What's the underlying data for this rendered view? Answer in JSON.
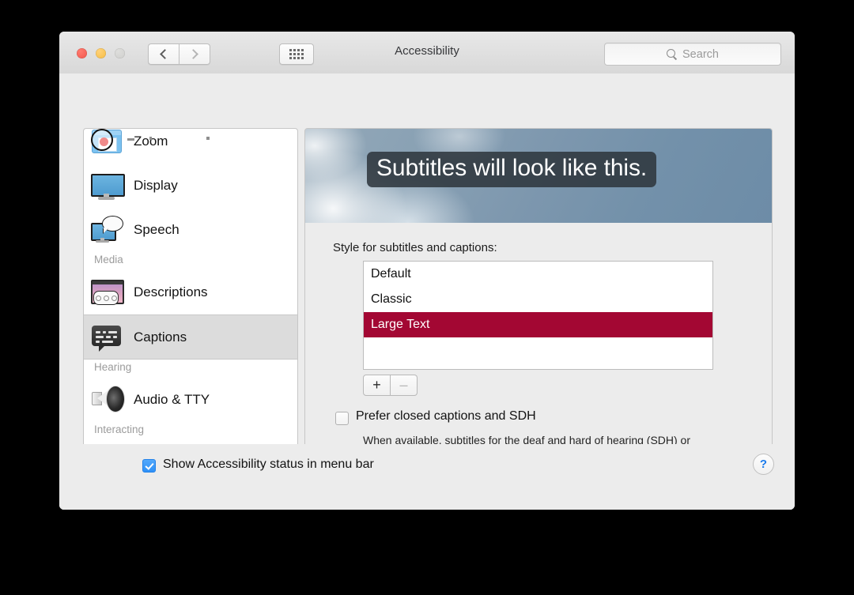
{
  "window": {
    "title": "Accessibility",
    "traffic_lights": [
      "close-button",
      "minimize-button",
      "zoom-button"
    ],
    "nav_back": "‹",
    "nav_forward": "›",
    "grid_button": "show-all-button",
    "search": {
      "placeholder": "Search",
      "value": "",
      "icon": "search-icon"
    }
  },
  "sidebar": {
    "items": [
      {
        "type": "item",
        "label": "Zoom",
        "icon": "zoom-icon",
        "selected": false
      },
      {
        "type": "item",
        "label": "Display",
        "icon": "display-icon",
        "selected": false
      },
      {
        "type": "item",
        "label": "Speech",
        "icon": "speech-icon",
        "selected": false
      },
      {
        "type": "group",
        "label": "Media"
      },
      {
        "type": "item",
        "label": "Descriptions",
        "icon": "descriptions-icon",
        "selected": false
      },
      {
        "type": "item",
        "label": "Captions",
        "icon": "captions-icon",
        "selected": true
      },
      {
        "type": "group",
        "label": "Hearing"
      },
      {
        "type": "item",
        "label": "Audio & TTY",
        "icon": "audio-tty-icon",
        "selected": false
      },
      {
        "type": "group",
        "label": "Interacting"
      },
      {
        "type": "item",
        "label": "",
        "icon": "keyboard-icon",
        "selected": false
      }
    ]
  },
  "panel": {
    "preview": {
      "caption_text": "Subtitles will look like this.",
      "caption_bg": "#2e363d",
      "caption_color": "#ffffff"
    },
    "style_label": "Style for subtitles and captions:",
    "styles": [
      {
        "label": "Default",
        "selected": false
      },
      {
        "label": "Classic",
        "selected": false
      },
      {
        "label": "Large Text",
        "selected": true
      }
    ],
    "selection_color": "#a30733",
    "add_button": "+",
    "remove_button": "–",
    "sdh": {
      "checked": false,
      "label": "Prefer closed captions and SDH",
      "description": "When available, subtitles for the deaf and hard of hearing (SDH) or closed captions will be used instead of standard subtitles."
    }
  },
  "bottom": {
    "menubar_checkbox_checked": true,
    "menubar_label": "Show Accessibility status in menu bar",
    "help_label": "?"
  }
}
